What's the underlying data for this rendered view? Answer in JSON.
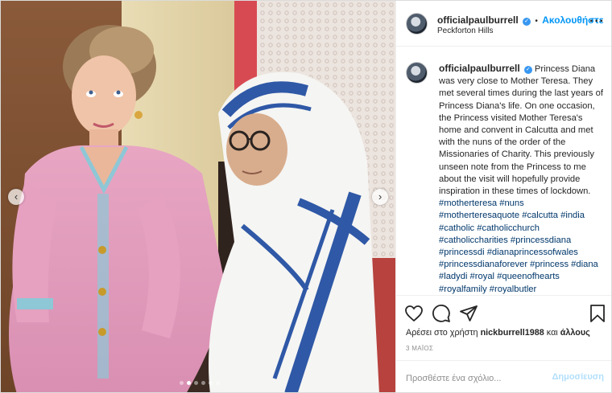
{
  "post": {
    "username": "officialpaulburrell",
    "follow_label": "Ακολουθήστε",
    "bullet": "•",
    "location": "Peckforton Hills",
    "more_icon": "more-horizontal-icon",
    "caption_text": "Princess Diana was very close to Mother Teresa. They met several times during the last years of Princess Diana's life. On one occasion, the Princess visited Mother Teresa's home and convent in Calcutta and met with the nuns of the order of the Missionaries of Charity. This previously unseen note from the Princess to me about the visit will hopefully provide inspiration in these times of lockdown.",
    "hashtags": "#motherteresa #nuns #motherteresaquote #calcutta #india #catholic #catholicchurch #catholiccharities #princessdiana #princessdi #dianaprincessofwales #princessdianaforever #princess #diana #ladydi #royal #queenofhearts #royalfamily #royalbutler",
    "likes_prefix": "Αρέσει στο χρήστη",
    "likes_user": "nickburrell1988",
    "likes_suffix": "και",
    "likes_others": "άλλους",
    "date": "3 ΜΑΪΟΣ",
    "comment_placeholder": "Προσθέστε ένα σχόλιο...",
    "post_button": "Δημοσίευση"
  },
  "carousel": {
    "prev_symbol": "‹",
    "next_symbol": "›",
    "slide_count": 6,
    "active_slide": 2
  },
  "colors": {
    "accent": "#0095f6",
    "hashtag": "#00376b",
    "muted": "#8e8e8e",
    "post_disabled": "#b2dffc"
  },
  "icons": [
    "heart-icon",
    "comment-icon",
    "share-icon",
    "bookmark-icon",
    "verified-badge-icon",
    "chevron-left-icon",
    "chevron-right-icon"
  ]
}
